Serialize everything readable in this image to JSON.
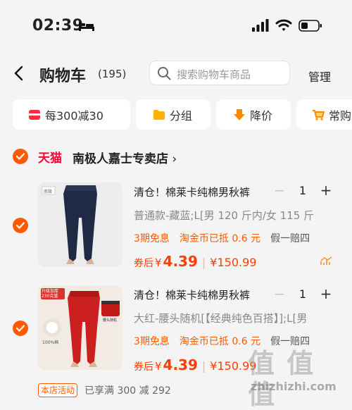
{
  "status_bar": {
    "time": "02:39"
  },
  "header": {
    "title": "购物车",
    "count": "(195)",
    "search_placeholder": "搜索购物车商品",
    "manage": "管理"
  },
  "filters": [
    {
      "label": "每300减30",
      "icon": "red-packet-icon"
    },
    {
      "label": "分组",
      "icon": "folder-icon"
    },
    {
      "label": "降价",
      "icon": "arrow-down-icon"
    },
    {
      "label": "常购",
      "icon": "cart-icon"
    }
  ],
  "shop": {
    "platform": "天猫",
    "name": "南极人嘉士专卖店"
  },
  "products": [
    {
      "title": "清仓！棉莱卡纯棉男秋裤",
      "quantity": "1",
      "sku": "普通款-藏蓝;L[男 120 斤内/女 115 斤",
      "tags": [
        "3期免息",
        "淘金币已抵 0.6 元",
        "假一赔四"
      ],
      "price_label": "券后",
      "price_currency": "¥",
      "price": "4.39",
      "original_price": "¥150.99",
      "image_label": "南极"
    },
    {
      "title": "清仓！棉莱卡纯棉男秋裤",
      "quantity": "1",
      "sku": "大红-腰头随机[【经典纯色百搭】];L[男",
      "tags": [
        "3期免息",
        "淘金币已抵 0.6 元",
        "假一赔四"
      ],
      "price_label": "券后",
      "price_currency": "¥",
      "price": "4.39",
      "original_price": "¥150.99",
      "image_label": "升级加厚 230克重",
      "image_sub_label": "100%棉",
      "image_tag": "腰头随机"
    }
  ],
  "promo": {
    "badge": "本店活动",
    "text": "已享满 300 减 292"
  },
  "watermark": {
    "text": "值 值 值",
    "url": "zhizhizhi.com"
  },
  "colors": {
    "accent": "#ff5a00",
    "price": "#ff3d00",
    "tmall": "#ff0036"
  }
}
